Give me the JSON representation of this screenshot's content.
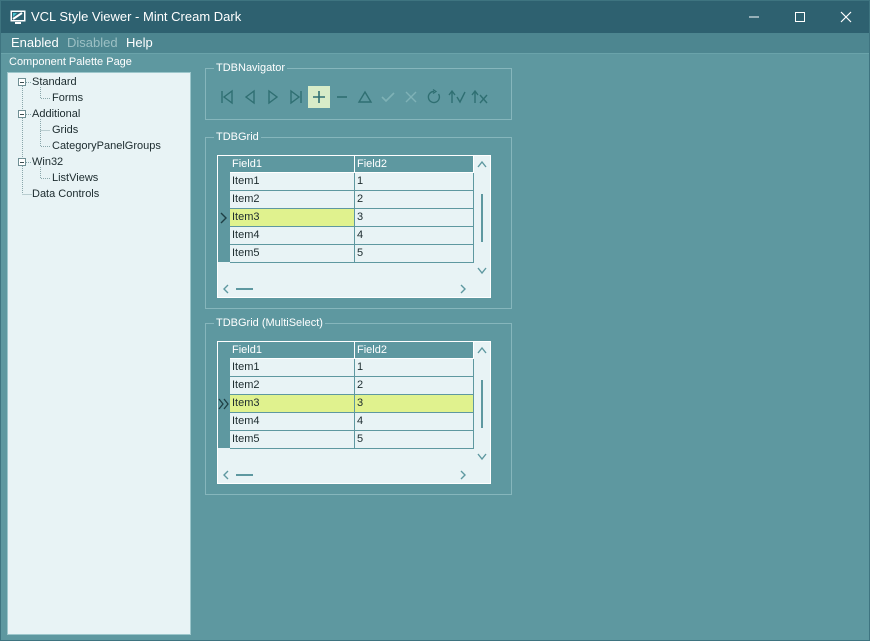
{
  "window": {
    "title": "VCL Style Viewer - Mint Cream Dark",
    "controls": [
      "minimize-icon",
      "maximize-icon",
      "close-icon"
    ]
  },
  "menu": {
    "items": [
      {
        "label": "Enabled",
        "enabled": true
      },
      {
        "label": "Disabled",
        "enabled": false
      },
      {
        "label": "Help",
        "enabled": true
      }
    ]
  },
  "palette": {
    "label": "Component Palette Page",
    "tree": [
      {
        "label": "Standard",
        "expanded": true,
        "children": [
          "Forms"
        ]
      },
      {
        "label": "Additional",
        "expanded": true,
        "children": [
          "Grids",
          "CategoryPanelGroups"
        ]
      },
      {
        "label": "Win32",
        "expanded": true,
        "children": [
          "ListViews"
        ]
      },
      {
        "label": "Data Controls",
        "expanded": false,
        "children": []
      }
    ]
  },
  "navigator": {
    "title": "TDBNavigator",
    "buttons": [
      "first-icon",
      "prior-icon",
      "next-icon",
      "last-icon",
      "insert-icon",
      "delete-icon",
      "edit-icon",
      "post-icon",
      "cancel-icon",
      "refresh-icon",
      "apply-updates-icon",
      "cancel-updates-icon"
    ],
    "active_button": "insert-icon"
  },
  "grid1": {
    "title": "TDBGrid",
    "columns": [
      "Field1",
      "Field2"
    ],
    "rows": [
      [
        "Item1",
        "1"
      ],
      [
        "Item2",
        "2"
      ],
      [
        "Item3",
        "3"
      ],
      [
        "Item4",
        "4"
      ],
      [
        "Item5",
        "5"
      ]
    ],
    "current_row": 2,
    "selected_cells": "Field1"
  },
  "grid2": {
    "title": "TDBGrid (MultiSelect)",
    "columns": [
      "Field1",
      "Field2"
    ],
    "rows": [
      [
        "Item1",
        "1"
      ],
      [
        "Item2",
        "2"
      ],
      [
        "Item3",
        "3"
      ],
      [
        "Item4",
        "4"
      ],
      [
        "Item5",
        "5"
      ]
    ],
    "current_row": 2,
    "selected_cells": "row"
  },
  "colors": {
    "title_bar": "#2e6170",
    "client_bg": "#5e98a0",
    "grid_bg": "#e8f3f5",
    "selection": "#e0f28e",
    "nav_active": "#d8ecc8",
    "icon": "#2f6f72"
  }
}
